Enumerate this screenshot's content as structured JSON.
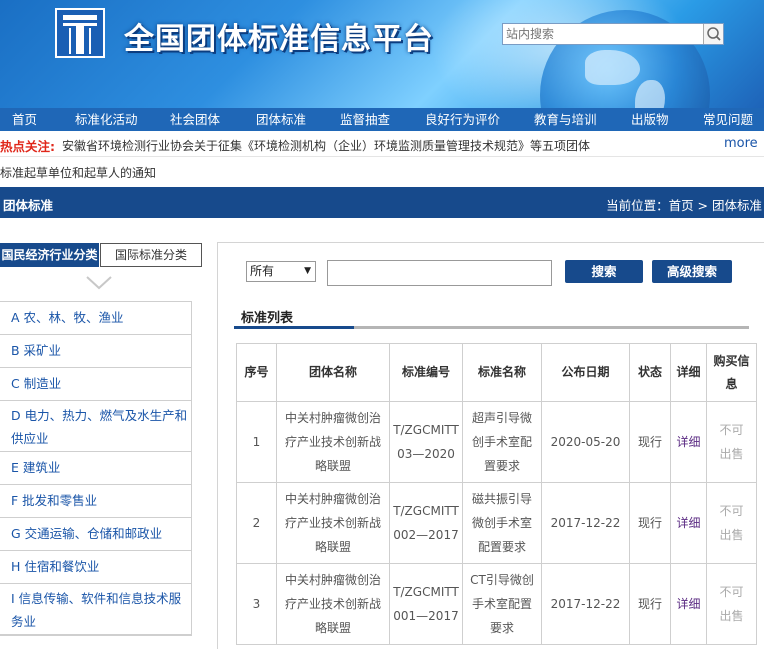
{
  "header": {
    "site_title": "全国团体标准信息平台",
    "search_placeholder": "站内搜索"
  },
  "nav": {
    "items": [
      "首页",
      "标准化活动",
      "社会团体",
      "团体标准",
      "监督抽查",
      "良好行为评价",
      "教育与培训",
      "出版物",
      "常见问题"
    ]
  },
  "notice": {
    "hot_label": "热点关注:",
    "hot_text": "安徽省环境检测行业协会关于征集《环境检测机构（企业）环境监测质量管理技术规范》等五项团体",
    "more": "more",
    "line2": "标准起草单位和起草人的通知"
  },
  "section": {
    "title": "团体标准",
    "breadcrumb": "当前位置：首页 > 团体标准"
  },
  "sidebar": {
    "tab_active": "国民经济行业分类",
    "tab_other": "国际标准分类",
    "categories": [
      "A 农、林、牧、渔业",
      "B 采矿业",
      "C 制造业",
      "D 电力、热力、燃气及水生产和供应业",
      "E 建筑业",
      "F 批发和零售业",
      "G 交通运输、仓储和邮政业",
      "H 住宿和餐饮业",
      "I 信息传输、软件和信息技术服务业"
    ]
  },
  "search": {
    "select_value": "所有",
    "search_button": "搜索",
    "advanced_button": "高级搜索"
  },
  "list": {
    "title": "标准列表",
    "headers": [
      "序号",
      "团体名称",
      "标准编号",
      "标准名称",
      "公布日期",
      "状态",
      "详细",
      "购买信息"
    ],
    "rows": [
      {
        "no": "1",
        "org": "中关村肿瘤微创治疗产业技术创新战略联盟",
        "code": "T/ZGCMITT 03—2020",
        "name": "超声引导微创手术室配置要求",
        "date": "2020-05-20",
        "status": "现行",
        "detail": "详细",
        "buy": "不可出售"
      },
      {
        "no": "2",
        "org": "中关村肿瘤微创治疗产业技术创新战略联盟",
        "code": "T/ZGCMITT 002—2017",
        "name": "磁共振引导微创手术室配置要求",
        "date": "2017-12-22",
        "status": "现行",
        "detail": "详细",
        "buy": "不可出售"
      },
      {
        "no": "3",
        "org": "中关村肿瘤微创治疗产业技术创新战略联盟",
        "code": "T/ZGCMITT 001—2017",
        "name": "CT引导微创手术室配置要求",
        "date": "2017-12-22",
        "status": "现行",
        "detail": "详细",
        "buy": "不可出售"
      }
    ]
  },
  "colors": {
    "nav_bg": "#1f67b7",
    "section_bg": "#174a8c",
    "hot_label": "#e0271a",
    "link": "#1a55a8"
  }
}
